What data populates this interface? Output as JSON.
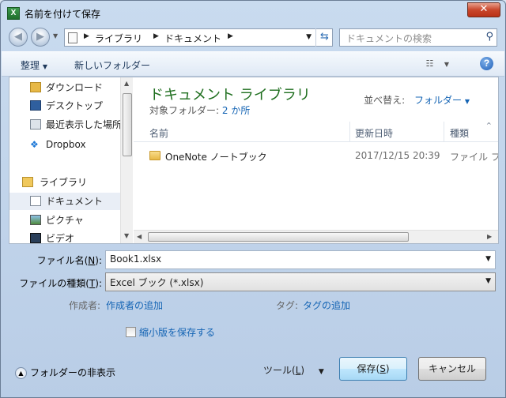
{
  "window": {
    "title": "名前を付けて保存",
    "app_icon_letter": "X"
  },
  "navigation": {
    "path": [
      "ライブラリ",
      "ドキュメント"
    ],
    "search_placeholder": "ドキュメントの検索"
  },
  "toolbar": {
    "organize": "整理",
    "new_folder": "新しいフォルダー",
    "help": "?"
  },
  "nav_pane": {
    "favorites": [
      {
        "label": "ダウンロード",
        "icon": "download-icon"
      },
      {
        "label": "デスクトップ",
        "icon": "desktop-icon"
      },
      {
        "label": "最近表示した場所",
        "icon": "recent-places-icon"
      },
      {
        "label": "Dropbox",
        "icon": "dropbox-icon"
      }
    ],
    "libraries_header": "ライブラリ",
    "libraries": [
      {
        "label": "ドキュメント",
        "icon": "document-icon",
        "selected": true
      },
      {
        "label": "ピクチャ",
        "icon": "picture-icon"
      },
      {
        "label": "ビデオ",
        "icon": "video-icon"
      }
    ]
  },
  "file_pane": {
    "library_title": "ドキュメント ライブラリ",
    "target_label": "対象フォルダー:",
    "target_link": "2 か所",
    "sort_label": "並べ替え:",
    "sort_value": "フォルダー",
    "columns": [
      "名前",
      "更新日時",
      "種類"
    ],
    "rows": [
      {
        "name": "OneNote ノートブック",
        "modified": "2017/12/15 20:39",
        "type": "ファイル フ"
      }
    ]
  },
  "form": {
    "filename_label_pre": "ファイル名(",
    "filename_label_key": "N",
    "filename_label_post": "):",
    "filename_value": "Book1.xlsx",
    "filetype_label_pre": "ファイルの種類(",
    "filetype_label_key": "T",
    "filetype_label_post": "):",
    "filetype_value": "Excel ブック (*.xlsx)",
    "author_label": "作成者:",
    "author_link": "作成者の追加",
    "tags_label": "タグ:",
    "tags_link": "タグの追加",
    "thumbnail_label": "縮小版を保存する"
  },
  "footer": {
    "hide_folders": "フォルダーの非表示",
    "tools_pre": "ツール(",
    "tools_key": "L",
    "tools_post": ")",
    "save_pre": "保存(",
    "save_key": "S",
    "save_post": ")",
    "cancel": "キャンセル"
  },
  "colors": {
    "accent_green": "#1e6e1e",
    "link_blue": "#1464b4",
    "close_red": "#c9462b"
  }
}
